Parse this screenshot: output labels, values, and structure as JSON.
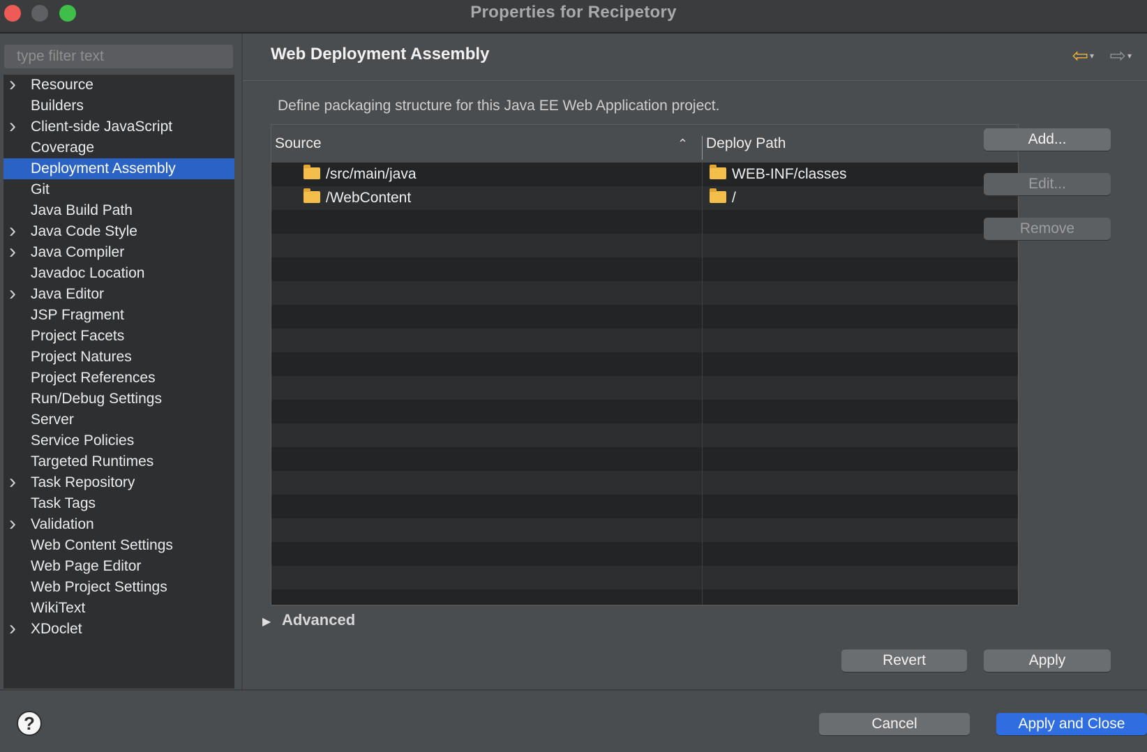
{
  "window": {
    "title": "Properties for Recipetory"
  },
  "sidebar": {
    "filter_placeholder": "type filter text",
    "items": [
      {
        "label": "Resource",
        "expandable": true
      },
      {
        "label": "Builders",
        "expandable": false
      },
      {
        "label": "Client-side JavaScript",
        "expandable": true
      },
      {
        "label": "Coverage",
        "expandable": false
      },
      {
        "label": "Deployment Assembly",
        "expandable": false,
        "selected": true
      },
      {
        "label": "Git",
        "expandable": false
      },
      {
        "label": "Java Build Path",
        "expandable": false
      },
      {
        "label": "Java Code Style",
        "expandable": true
      },
      {
        "label": "Java Compiler",
        "expandable": true
      },
      {
        "label": "Javadoc Location",
        "expandable": false
      },
      {
        "label": "Java Editor",
        "expandable": true
      },
      {
        "label": "JSP Fragment",
        "expandable": false
      },
      {
        "label": "Project Facets",
        "expandable": false
      },
      {
        "label": "Project Natures",
        "expandable": false
      },
      {
        "label": "Project References",
        "expandable": false
      },
      {
        "label": "Run/Debug Settings",
        "expandable": false
      },
      {
        "label": "Server",
        "expandable": false
      },
      {
        "label": "Service Policies",
        "expandable": false
      },
      {
        "label": "Targeted Runtimes",
        "expandable": false
      },
      {
        "label": "Task Repository",
        "expandable": true
      },
      {
        "label": "Task Tags",
        "expandable": false
      },
      {
        "label": "Validation",
        "expandable": true
      },
      {
        "label": "Web Content Settings",
        "expandable": false
      },
      {
        "label": "Web Page Editor",
        "expandable": false
      },
      {
        "label": "Web Project Settings",
        "expandable": false
      },
      {
        "label": "WikiText",
        "expandable": false
      },
      {
        "label": "XDoclet",
        "expandable": true
      }
    ]
  },
  "main": {
    "title": "Web Deployment Assembly",
    "description": "Define packaging structure for this Java EE Web Application project.",
    "table": {
      "columns": [
        "Source",
        "Deploy Path"
      ],
      "rows": [
        {
          "source": "/src/main/java",
          "deploy_path": "WEB-INF/classes"
        },
        {
          "source": "/WebContent",
          "deploy_path": "/"
        }
      ]
    },
    "buttons": {
      "add": "Add...",
      "edit": "Edit...",
      "remove": "Remove",
      "revert": "Revert",
      "apply": "Apply"
    },
    "advanced_label": "Advanced"
  },
  "footer": {
    "help_icon": "?",
    "cancel": "Cancel",
    "apply_and_close": "Apply and Close"
  },
  "colors": {
    "selection": "#2b63c4",
    "primary_button": "#2f6ee0",
    "folder": "#f3be4a",
    "back_arrow": "#f2b33a"
  },
  "icons": {
    "back": "arrow-left-icon",
    "forward": "arrow-right-icon",
    "folder": "folder-icon",
    "help": "help-icon"
  }
}
